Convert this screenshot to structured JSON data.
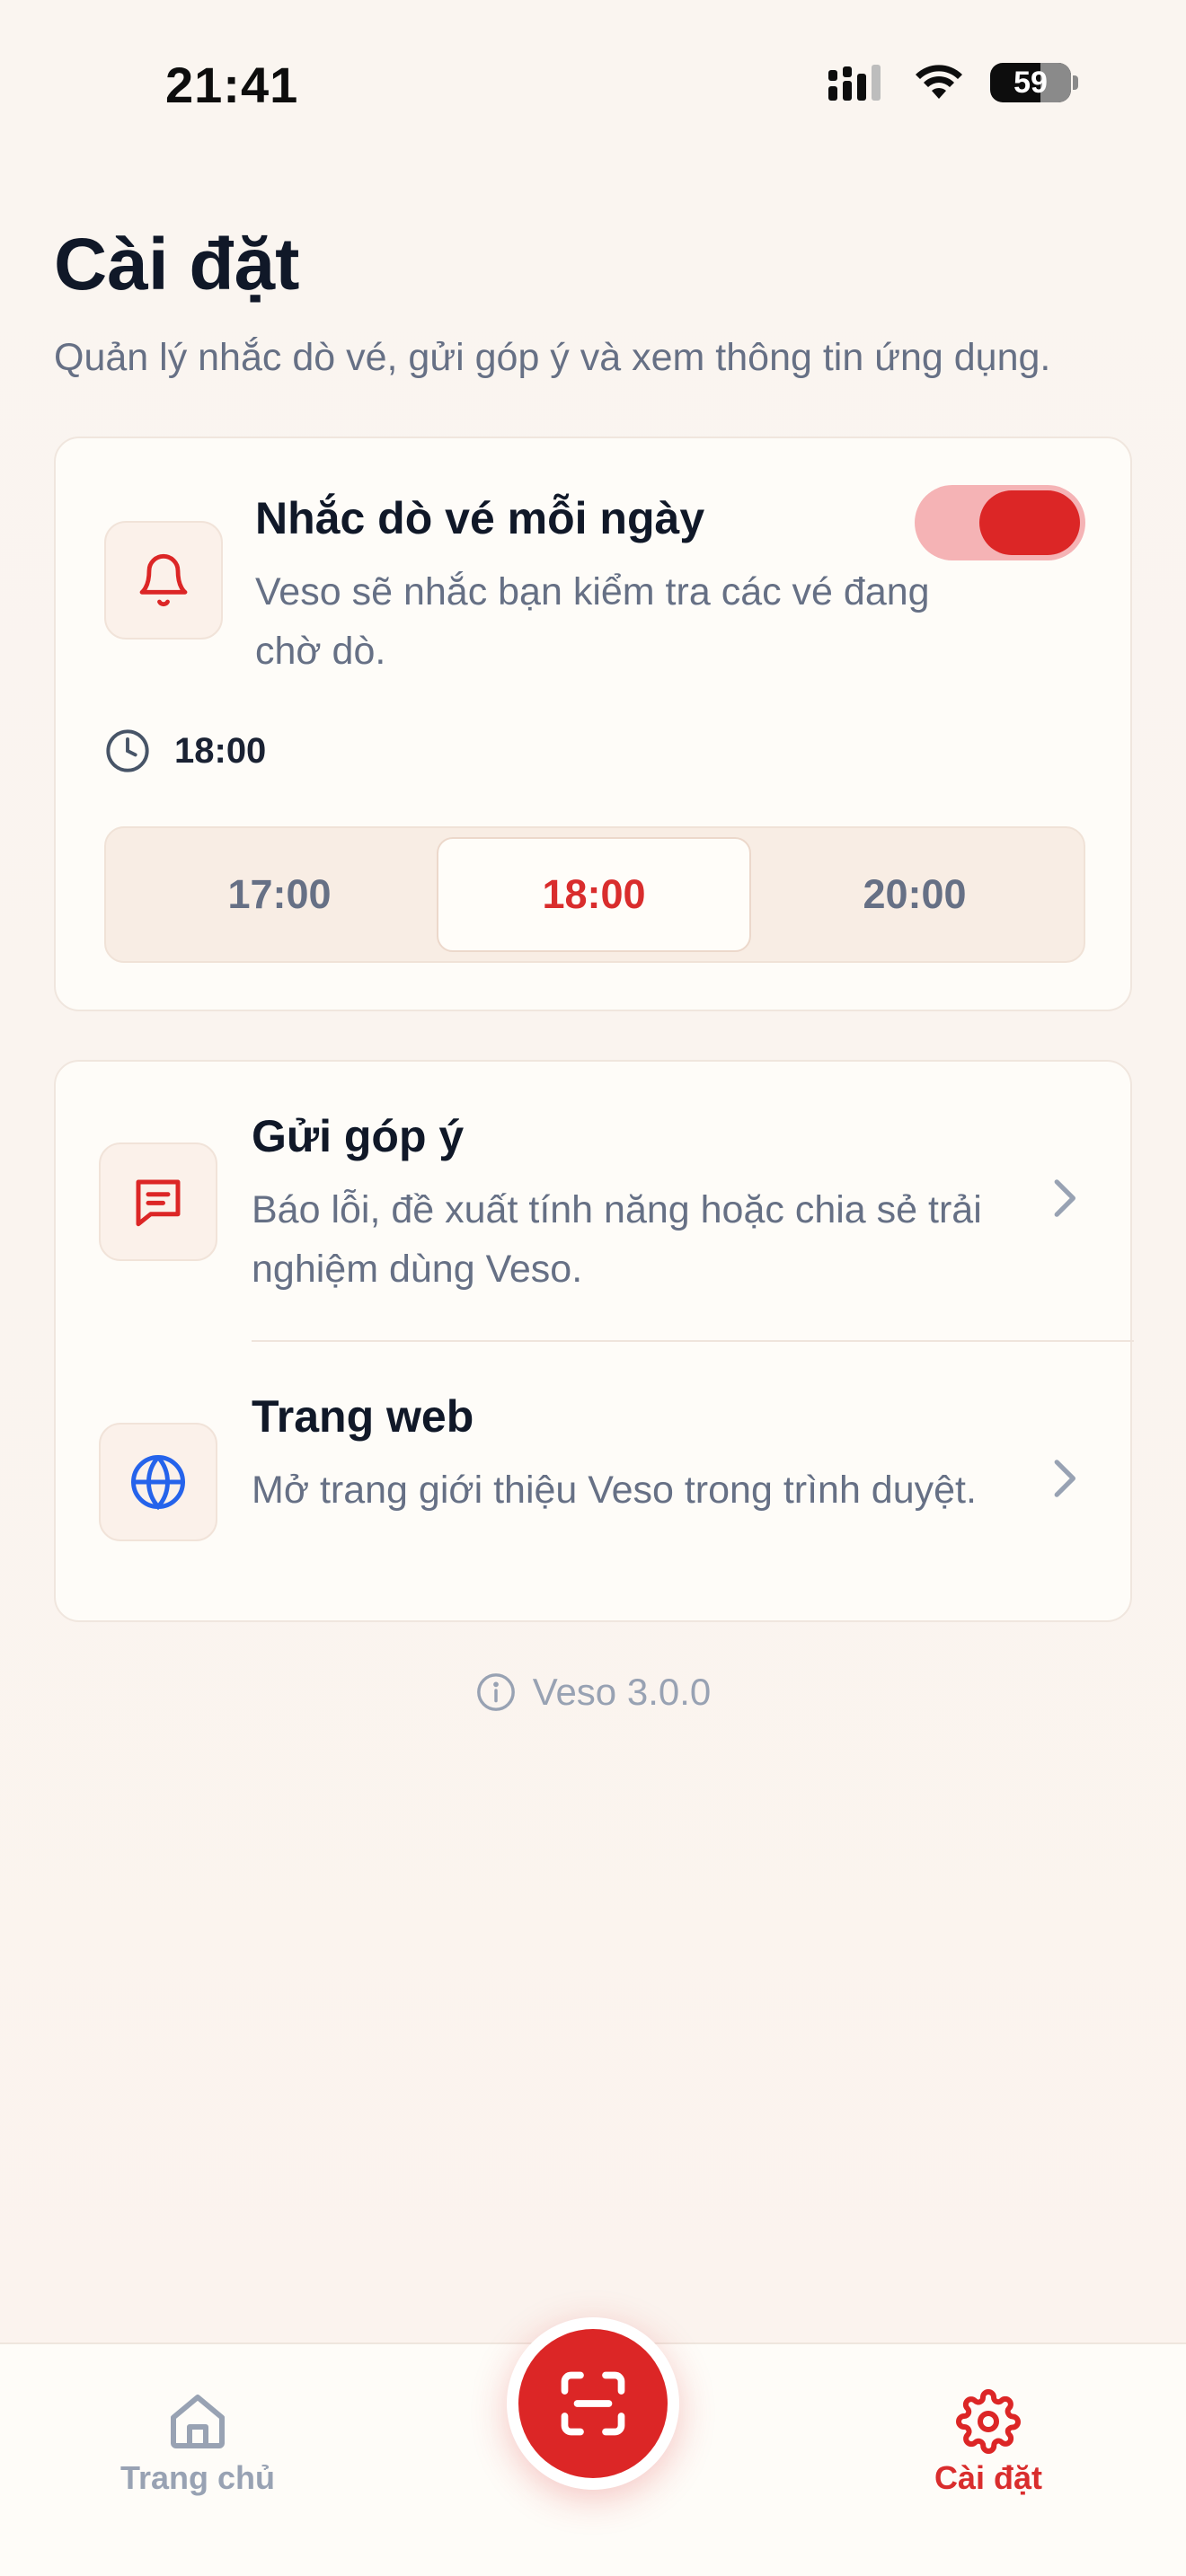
{
  "status_bar": {
    "time": "21:41",
    "battery": "59",
    "icons": [
      "cellular-signal-icon",
      "wifi-icon",
      "battery-icon"
    ]
  },
  "header": {
    "title": "Cài đặt",
    "subtitle": "Quản lý nhắc dò vé, gửi góp ý và xem thông tin ứng dụng."
  },
  "reminder": {
    "title": "Nhắc dò vé mỗi ngày",
    "description": "Veso sẽ nhắc bạn kiểm tra các vé đang chờ dò.",
    "enabled": true,
    "current_time": "18:00",
    "options": [
      "17:00",
      "18:00",
      "20:00"
    ],
    "selected": "18:00"
  },
  "links": [
    {
      "title": "Gửi góp ý",
      "description": "Báo lỗi, đề xuất tính năng hoặc chia sẻ trải nghiệm dùng Veso.",
      "icon": "message-icon"
    },
    {
      "title": "Trang web",
      "description": "Mở trang giới thiệu Veso trong trình duyệt.",
      "icon": "globe-icon"
    }
  ],
  "version": "Veso 3.0.0",
  "nav": {
    "home_label": "Trang chủ",
    "settings_label": "Cài đặt",
    "active": "settings"
  },
  "colors": {
    "accent": "#dc2626",
    "toggle_track": "#f5b3b5",
    "background": "#faf4ef",
    "globe": "#2563eb"
  }
}
